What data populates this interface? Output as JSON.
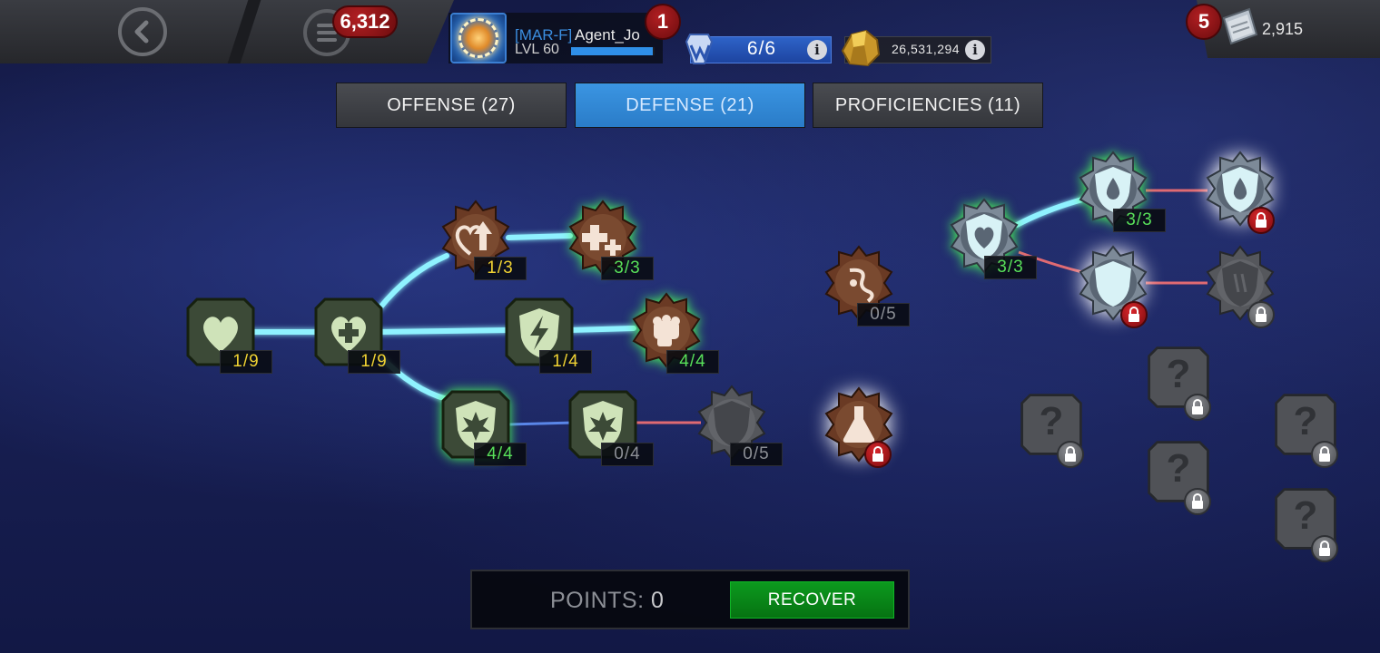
{
  "header": {
    "back_icon": "back-arrow-icon",
    "menu_icon": "menu-icon",
    "notification_count": "6,312",
    "profile": {
      "alliance_tag": "[MAR-F]",
      "name": "Agent_Jo",
      "level": "LVL 60",
      "xp_progress": 0.98,
      "badge": "1"
    },
    "energy": {
      "value": "6/6",
      "icon": "energy-icon"
    },
    "gold": {
      "value": "26,531,294",
      "icon": "gold-icon"
    },
    "units": {
      "badge": "5",
      "value": "2,915",
      "icon": "units-icon"
    }
  },
  "tabs": [
    {
      "label": "OFFENSE (27)",
      "active": false
    },
    {
      "label": "DEFENSE (21)",
      "active": true
    },
    {
      "label": "PROFICIENCIES (11)",
      "active": false
    }
  ],
  "nodes": [
    {
      "id": "health",
      "icon": "heart-icon",
      "count": "1/9",
      "color": "yellow"
    },
    {
      "id": "recovery",
      "icon": "heart-plus-icon",
      "count": "1/9",
      "color": "yellow"
    },
    {
      "id": "willpower",
      "icon": "heart-arrow-icon",
      "count": "1/3",
      "color": "yellow"
    },
    {
      "id": "salve",
      "icon": "double-plus-icon",
      "count": "3/3",
      "color": "green"
    },
    {
      "id": "block-prof",
      "icon": "shield-lightning-icon",
      "count": "1/4",
      "color": "yellow"
    },
    {
      "id": "resilience",
      "icon": "fist-icon",
      "count": "4/4",
      "color": "green"
    },
    {
      "id": "perfect-block",
      "icon": "starburst-shield-icon",
      "count": "4/4",
      "color": "green"
    },
    {
      "id": "stand-your-ground",
      "icon": "starburst-shield-icon",
      "count": "0/4",
      "color": "gray"
    },
    {
      "id": "block-chance",
      "icon": "shield-icon",
      "count": "0/5",
      "color": "gray"
    },
    {
      "id": "despair",
      "icon": "vine-icon",
      "count": "0/5",
      "color": "gray"
    },
    {
      "id": "flask",
      "icon": "flask-icon",
      "count": "",
      "color": "gray"
    },
    {
      "id": "inequity",
      "icon": "heart-shield-icon",
      "count": "3/3",
      "color": "green"
    },
    {
      "id": "liquid-courage",
      "icon": "droplet-shield-icon",
      "count": "3/3",
      "color": "green"
    },
    {
      "id": "double-edge",
      "icon": "droplet-shield-icon",
      "count": "",
      "color": "gray"
    },
    {
      "id": "collar-tech",
      "icon": "blank-shield-icon",
      "count": "",
      "color": "gray"
    },
    {
      "id": "suture",
      "icon": "claw-shield-icon",
      "count": "",
      "color": "gray"
    }
  ],
  "unknown_node_label": "?",
  "footer": {
    "points_label": "POINTS:",
    "points_value": "0",
    "recover_label": "RECOVER"
  }
}
